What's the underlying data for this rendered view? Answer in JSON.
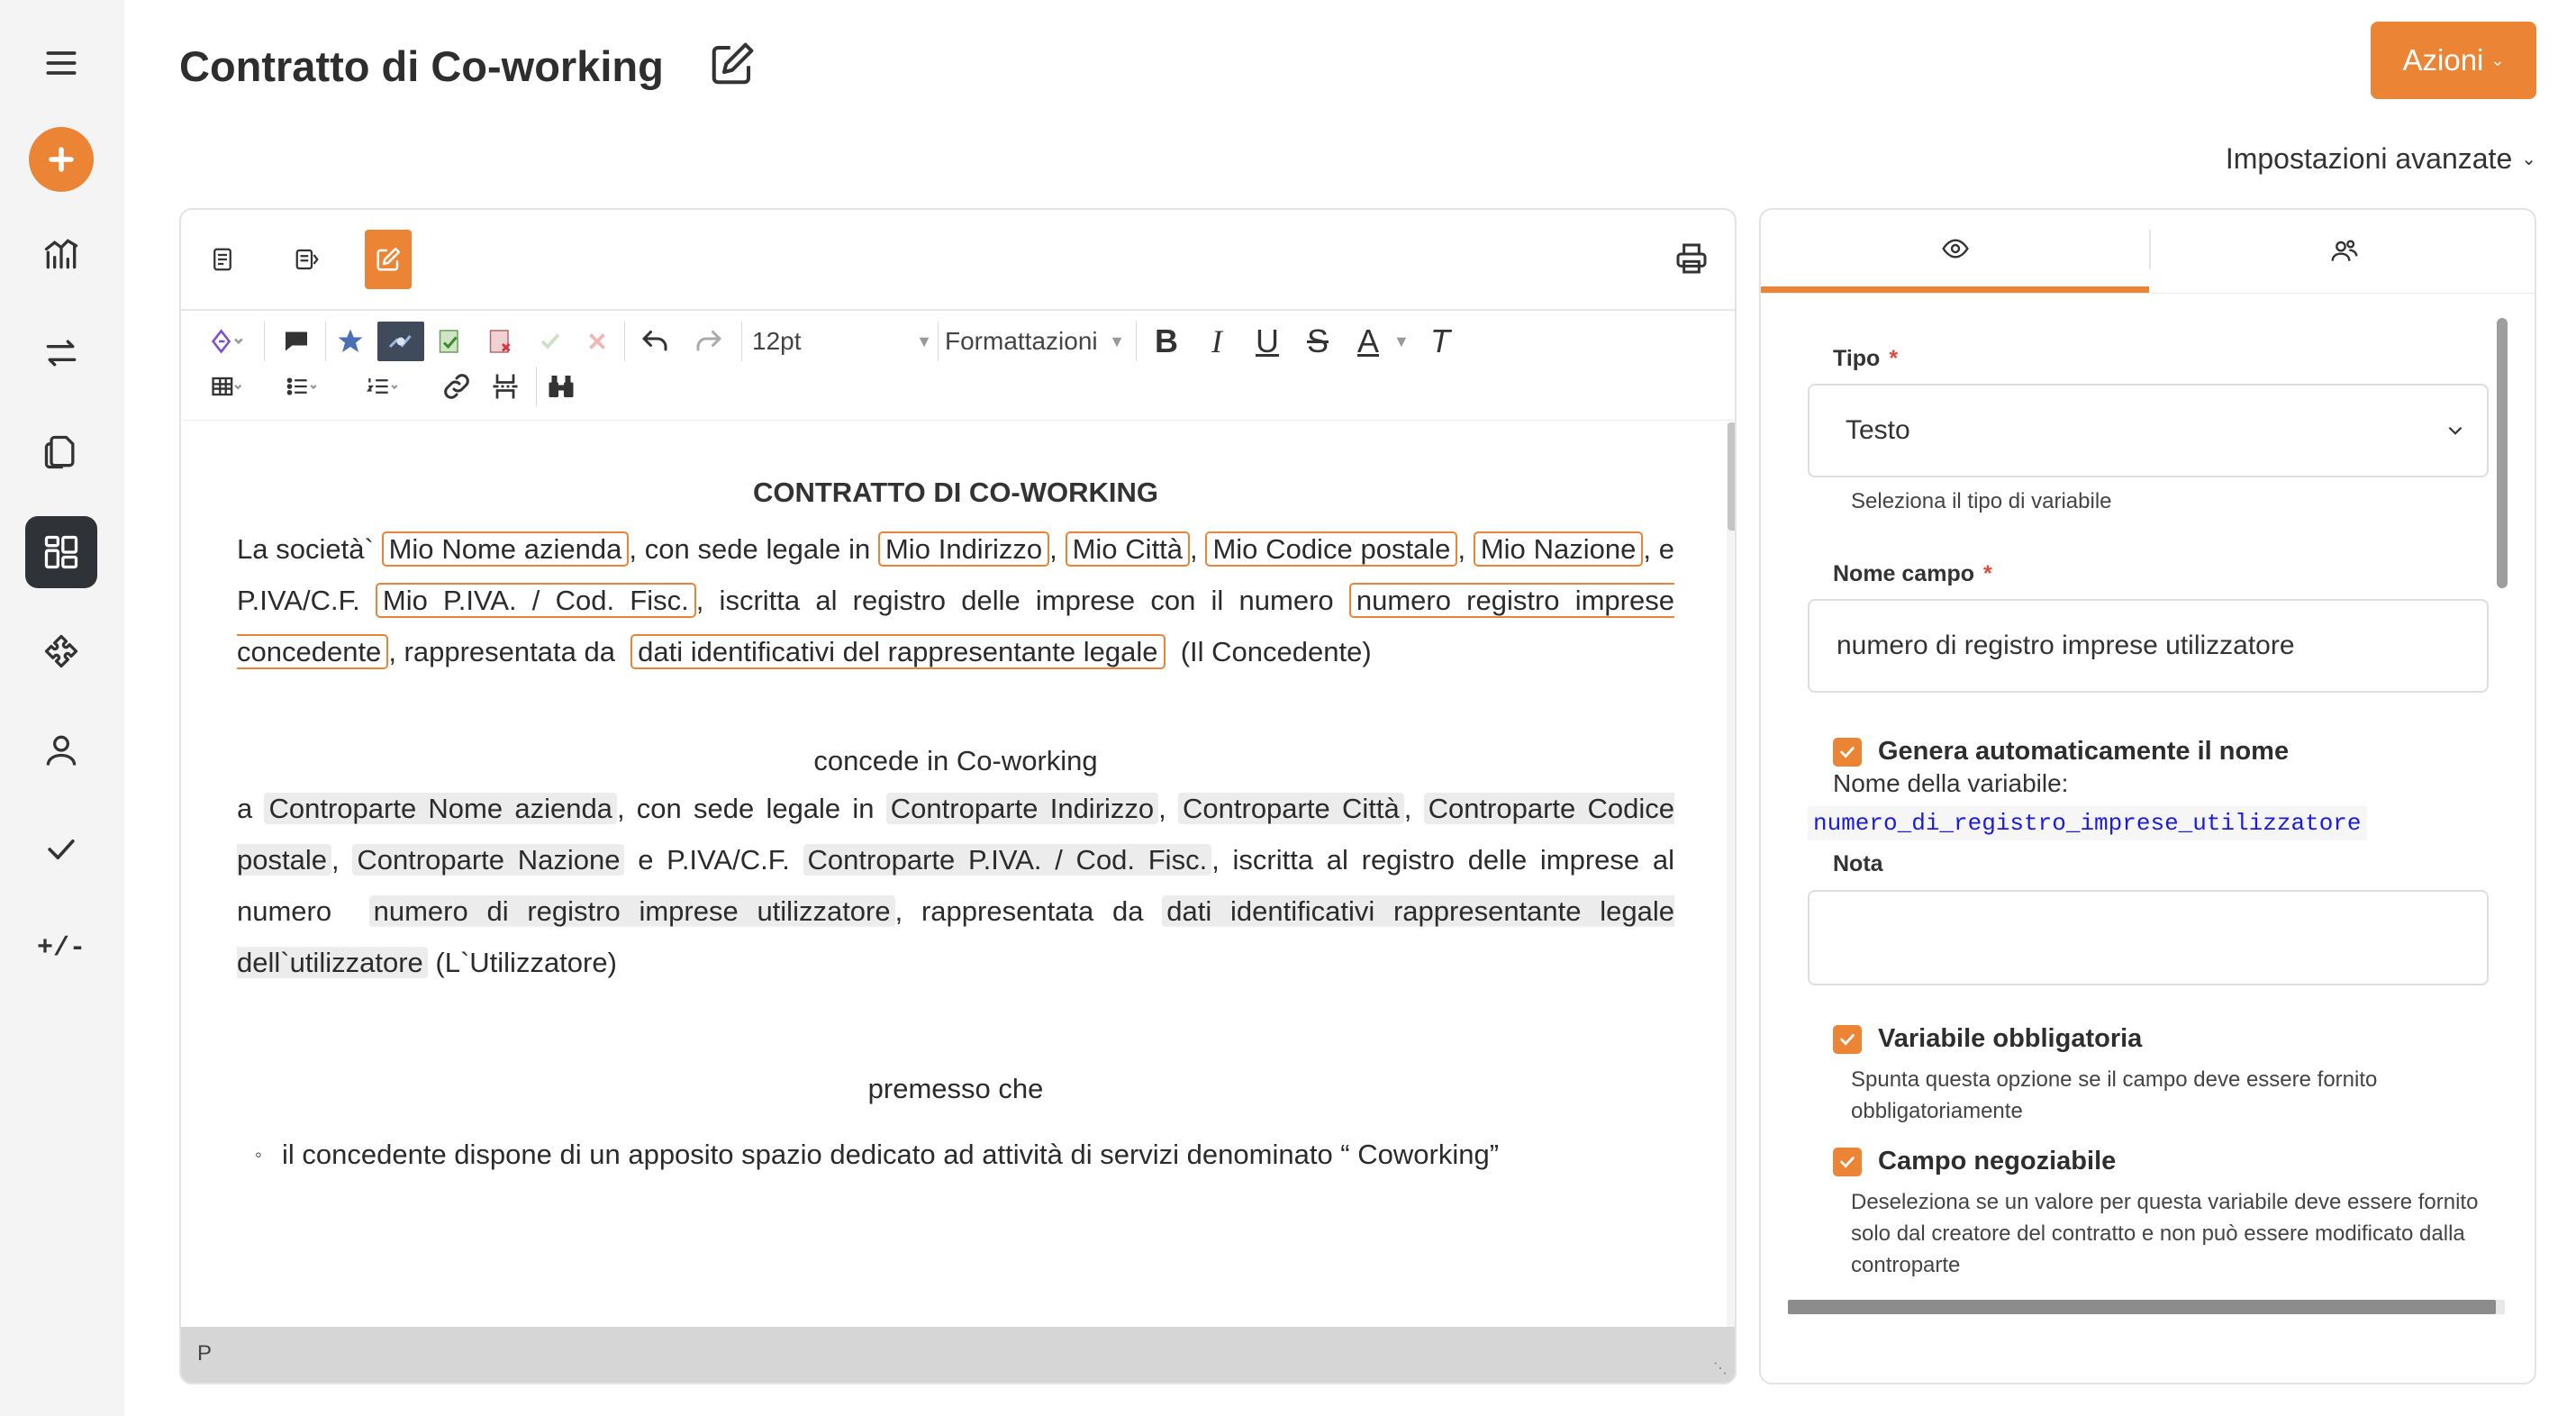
{
  "header": {
    "title": "Contratto di Co-working",
    "actions_label": "Azioni",
    "advanced_settings_label": "Impostazioni avanzate"
  },
  "sidebar": {
    "items": [
      "menu-icon",
      "add-icon",
      "chart-icon",
      "swap-icon",
      "documents-icon",
      "templates-icon",
      "puzzle-icon",
      "user-icon",
      "check-icon",
      "diff-icon"
    ],
    "diff_label": "+/-"
  },
  "toolbar": {
    "font_size": "12pt",
    "formats_label": "Formattazioni",
    "bold": "B",
    "italic": "I",
    "underline": "U",
    "strike": "S",
    "font_color": "A",
    "clear": "T"
  },
  "document": {
    "title": "CONTRATTO DI CO-WORKING",
    "p1": {
      "t1": "La società`",
      "v1": "Mio Nome azienda",
      "t2": ", con sede legale in",
      "v2": "Mio Indirizzo",
      "t3": ",",
      "v3": "Mio Città",
      "t4": ",",
      "v4": "Mio Codice postale",
      "t5": ",",
      "v5": "Mio Nazione",
      "t6": ", e P.IVA/C.F.",
      "v6": "Mio P.IVA. / Cod. Fisc.",
      "t7": ", iscritta al registro delle imprese con il numero",
      "v7": "numero registro imprese concedente",
      "t8": ", rappresentata da",
      "v8": "dati identificativi del rappresentante legale",
      "t9": "(Il Concedente)"
    },
    "grant": "concede in Co-working",
    "p2": {
      "t1": "a",
      "v1": "Controparte Nome azienda",
      "t2": ", con sede legale in",
      "v2": "Controparte Indirizzo",
      "t3": ",",
      "v3": "Controparte Città",
      "t4": ",",
      "v4": "Controparte Codice postale",
      "t5": ",",
      "v5": "Controparte Nazione",
      "t6": "e P.IVA/C.F.",
      "v6": "Controparte P.IVA. / Cod. Fisc.",
      "t7": ", iscritta al registro delle imprese al numero",
      "v7": "numero di registro imprese utilizzatore",
      "t8": ", rappresentata da",
      "v8": "dati identificativi rappresentante legale dell`utilizzatore",
      "t9": "(L`Utilizzatore)"
    },
    "premise": "premesso che",
    "bullet1": "il concedente dispone di un apposito spazio dedicato ad attività di servizi denominato “ Coworking”",
    "status_path": "P"
  },
  "panel": {
    "type_label": "Tipo",
    "required_mark": "*",
    "type_value": "Testo",
    "type_help": "Seleziona il tipo di variabile",
    "field_name_label": "Nome campo",
    "field_name_value": "numero di registro imprese utilizzatore",
    "auto_name_label": "Genera automaticamente il nome",
    "var_name_label": "Nome della variabile:",
    "var_name_value": "numero_di_registro_imprese_utilizzatore",
    "note_label": "Nota",
    "mandatory_label": "Variabile obbligatoria",
    "mandatory_help": "Spunta questa opzione se il campo deve essere fornito obbligatoriamente",
    "negotiable_label": "Campo negoziabile",
    "negotiable_help": "Deseleziona se un valore per questa variabile deve essere fornito solo dal creatore del contratto e non può essere modificato dalla controparte"
  },
  "colors": {
    "accent": "#ec8436",
    "sidebar_bg": "#f4f4f4",
    "sidebar_active": "#2f3236",
    "variable_link": "#1a1ae6"
  }
}
